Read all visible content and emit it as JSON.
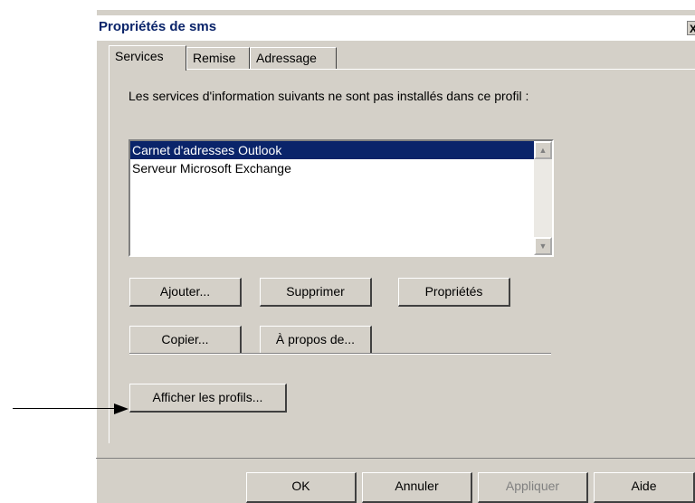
{
  "dialog": {
    "title": "Propriétés de sms",
    "close_label": "X"
  },
  "tabs": [
    {
      "label": "Services"
    },
    {
      "label": "Remise"
    },
    {
      "label": "Adressage"
    }
  ],
  "services": {
    "description": "Les services d'information suivants ne sont pas installés dans ce profil :",
    "items": [
      {
        "label": "Carnet d'adresses Outlook",
        "selected": true
      },
      {
        "label": "Serveur Microsoft Exchange",
        "selected": false
      }
    ],
    "buttons": {
      "add": "Ajouter...",
      "remove": "Supprimer",
      "properties": "Propriétés",
      "copy": "Copier...",
      "about": "À propos de...",
      "show_profiles": "Afficher les profils..."
    }
  },
  "footer": {
    "ok": "OK",
    "cancel": "Annuler",
    "apply": "Appliquer",
    "help": "Aide"
  },
  "colors": {
    "dialog_bg": "#d4d0c8",
    "selection": "#0a246a",
    "title": "#0a246a"
  }
}
